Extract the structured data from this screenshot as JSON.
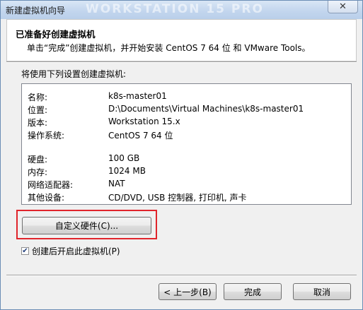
{
  "window": {
    "title": "新建虚拟机向导",
    "watermark": "WORKSTATION 15 PRO",
    "close_glyph": "✕"
  },
  "header": {
    "title": "已准备好创建虚拟机",
    "subtitle": "单击“完成”创建虚拟机，并开始安装 CentOS 7 64 位 和 VMware Tools。"
  },
  "settings_label": "将使用下列设置创建虚拟机:",
  "summary": {
    "rows": [
      {
        "key": "名称:",
        "value": "k8s-master01"
      },
      {
        "key": "位置:",
        "value": "D:\\Documents\\Virtual Machines\\k8s-master01"
      },
      {
        "key": "版本:",
        "value": "Workstation 15.x"
      },
      {
        "key": "操作系统:",
        "value": "CentOS 7 64 位"
      },
      {
        "key": "硬盘:",
        "value": "100 GB"
      },
      {
        "key": "内存:",
        "value": "1024 MB"
      },
      {
        "key": "网络适配器:",
        "value": "NAT"
      },
      {
        "key": "其他设备:",
        "value": "CD/DVD, USB 控制器, 打印机, 声卡"
      }
    ]
  },
  "customize_button": "自定义硬件(C)...",
  "power_on_checkbox": {
    "label": "创建后开启此虚拟机(P)",
    "checked": true,
    "check_glyph": "✔"
  },
  "footer": {
    "back": "< 上一步(B)",
    "finish": "完成",
    "cancel": "取消"
  },
  "colors": {
    "highlight_border": "#e0242b"
  }
}
